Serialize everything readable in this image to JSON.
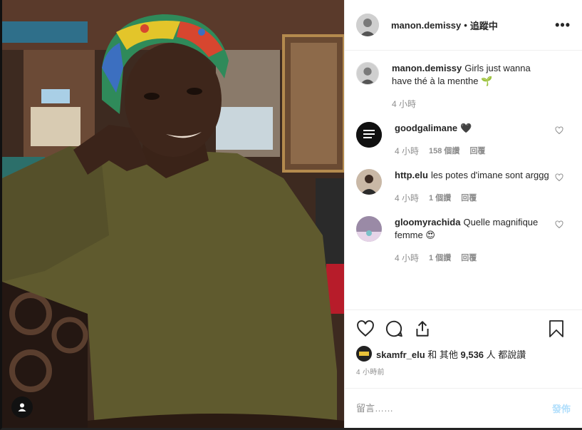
{
  "post": {
    "photo_icon": "user-tag-icon"
  },
  "header": {
    "username": "manon.demissy",
    "separator": "•",
    "follow_status": "追蹤中",
    "more_icon": "more-options-icon",
    "more_label": "•••"
  },
  "comments": [
    {
      "username": "manon.demissy",
      "text": "Girls just wanna have thé à la menthe 🌱",
      "time": "4 小時",
      "likes": "",
      "reply": ""
    },
    {
      "username": "goodgalimane",
      "text": "🖤",
      "time": "4 小時",
      "likes": "158 個讚",
      "reply": "回覆"
    },
    {
      "username": "http.elu",
      "text": "les potes d'imane sont arggg",
      "time": "4 小時",
      "likes": "1 個讚",
      "reply": "回覆"
    },
    {
      "username": "gloomyrachida",
      "text": "Quelle magnifique femme 😍",
      "time": "4 小時",
      "likes": "1 個讚",
      "reply": "回覆"
    }
  ],
  "actions": {
    "like_icon": "heart-icon",
    "comment_icon": "comment-icon",
    "share_icon": "share-icon",
    "save_icon": "bookmark-icon",
    "liked_by_user": "skamfr_elu",
    "liked_by_rest": " 和 其他 ",
    "liked_count": "9,536",
    "liked_suffix": " 人 都說讚",
    "timestamp": "4 小時前"
  },
  "add_comment": {
    "placeholder": "留言……",
    "post_label": "發佈"
  },
  "colors": {
    "link_disabled": "#b2dffc",
    "meta_gray": "#8e8e8e",
    "text": "#262626"
  }
}
